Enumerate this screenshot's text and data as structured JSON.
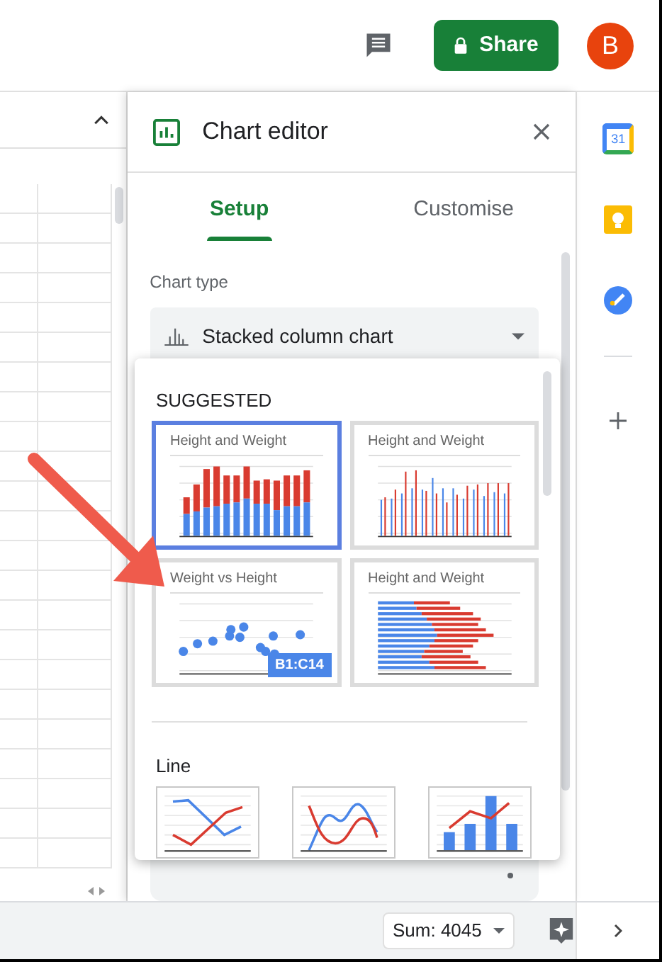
{
  "topbar": {
    "share_button": "Share",
    "avatar": "B"
  },
  "side_panel": {
    "calendar_icon_label": "31"
  },
  "chart_editor": {
    "title": "Chart editor",
    "tabs": [
      {
        "label": "Setup",
        "selected": true
      },
      {
        "label": "Customise",
        "selected": false
      }
    ],
    "chart_type_label": "Chart type",
    "chart_type_value": "Stacked column chart"
  },
  "chart_type_menu": {
    "suggested_heading": "SUGGESTED",
    "suggested": [
      {
        "kind": "stacked",
        "title": "Height and Weight",
        "selected": true
      },
      {
        "kind": "column",
        "title": "Height and Weight",
        "selected": false
      },
      {
        "kind": "scatter",
        "title": "Weight vs Height",
        "selected": false,
        "range_badge": "B1:C14"
      },
      {
        "kind": "bar",
        "title": "Height and Weight",
        "selected": false
      }
    ],
    "line_heading": "Line",
    "line_options": [
      {
        "kind": "line",
        "selected": false
      },
      {
        "kind": "smooth",
        "selected": false
      },
      {
        "kind": "combo",
        "selected": false
      }
    ]
  },
  "status_bar": {
    "sum": "Sum: 4045"
  }
}
